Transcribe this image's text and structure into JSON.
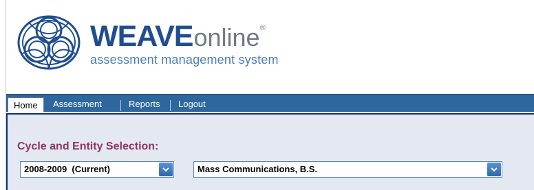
{
  "brand": {
    "name_bold": "WEAVE",
    "name_light": "online",
    "registered_mark": "®",
    "tagline": "assessment management system"
  },
  "nav": {
    "tabs": [
      {
        "label": "Home",
        "active": true
      },
      {
        "label": "Assessment",
        "active": false
      },
      {
        "label": "Reports",
        "active": false
      },
      {
        "label": "Logout",
        "active": false
      }
    ]
  },
  "selection": {
    "title": "Cycle and Entity Selection:",
    "cycle_value": "2008-2009  (Current)",
    "entity_value": "Mass Communications, B.S."
  },
  "colors": {
    "navbar": "#2d679e",
    "panel_bg": "#e4e9f1",
    "panel_border": "#0f2f75",
    "title": "#8e3565",
    "brand_blue": "#1f4d8f",
    "dropdown_button": "#2c67b1"
  },
  "icons": {
    "logo": "interlaced-globe-icon",
    "dropdown": "chevron-down-icon"
  }
}
